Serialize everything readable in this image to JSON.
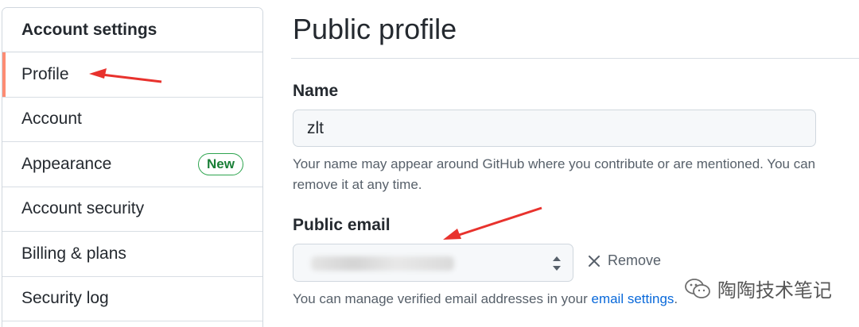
{
  "sidebar": {
    "header": "Account settings",
    "items": [
      {
        "label": "Profile",
        "selected": true
      },
      {
        "label": "Account"
      },
      {
        "label": "Appearance",
        "badge": "New"
      },
      {
        "label": "Account security"
      },
      {
        "label": "Billing & plans"
      },
      {
        "label": "Security log"
      }
    ]
  },
  "main": {
    "title": "Public profile",
    "name": {
      "label": "Name",
      "value": "zlt",
      "help": "Your name may appear around GitHub where you contribute or are mentioned. You can remove it at any time."
    },
    "email": {
      "label": "Public email",
      "remove_label": "Remove",
      "help_prefix": "You can manage verified email addresses in your ",
      "help_link": "email settings",
      "help_suffix": "."
    }
  },
  "watermark": {
    "text": "陶陶技术笔记",
    "icon": "wechat-icon"
  },
  "colors": {
    "selected_indicator": "#fd8c73",
    "new_badge": "#2da44e",
    "link": "#0969da",
    "annotation_arrow": "#e8322d"
  }
}
